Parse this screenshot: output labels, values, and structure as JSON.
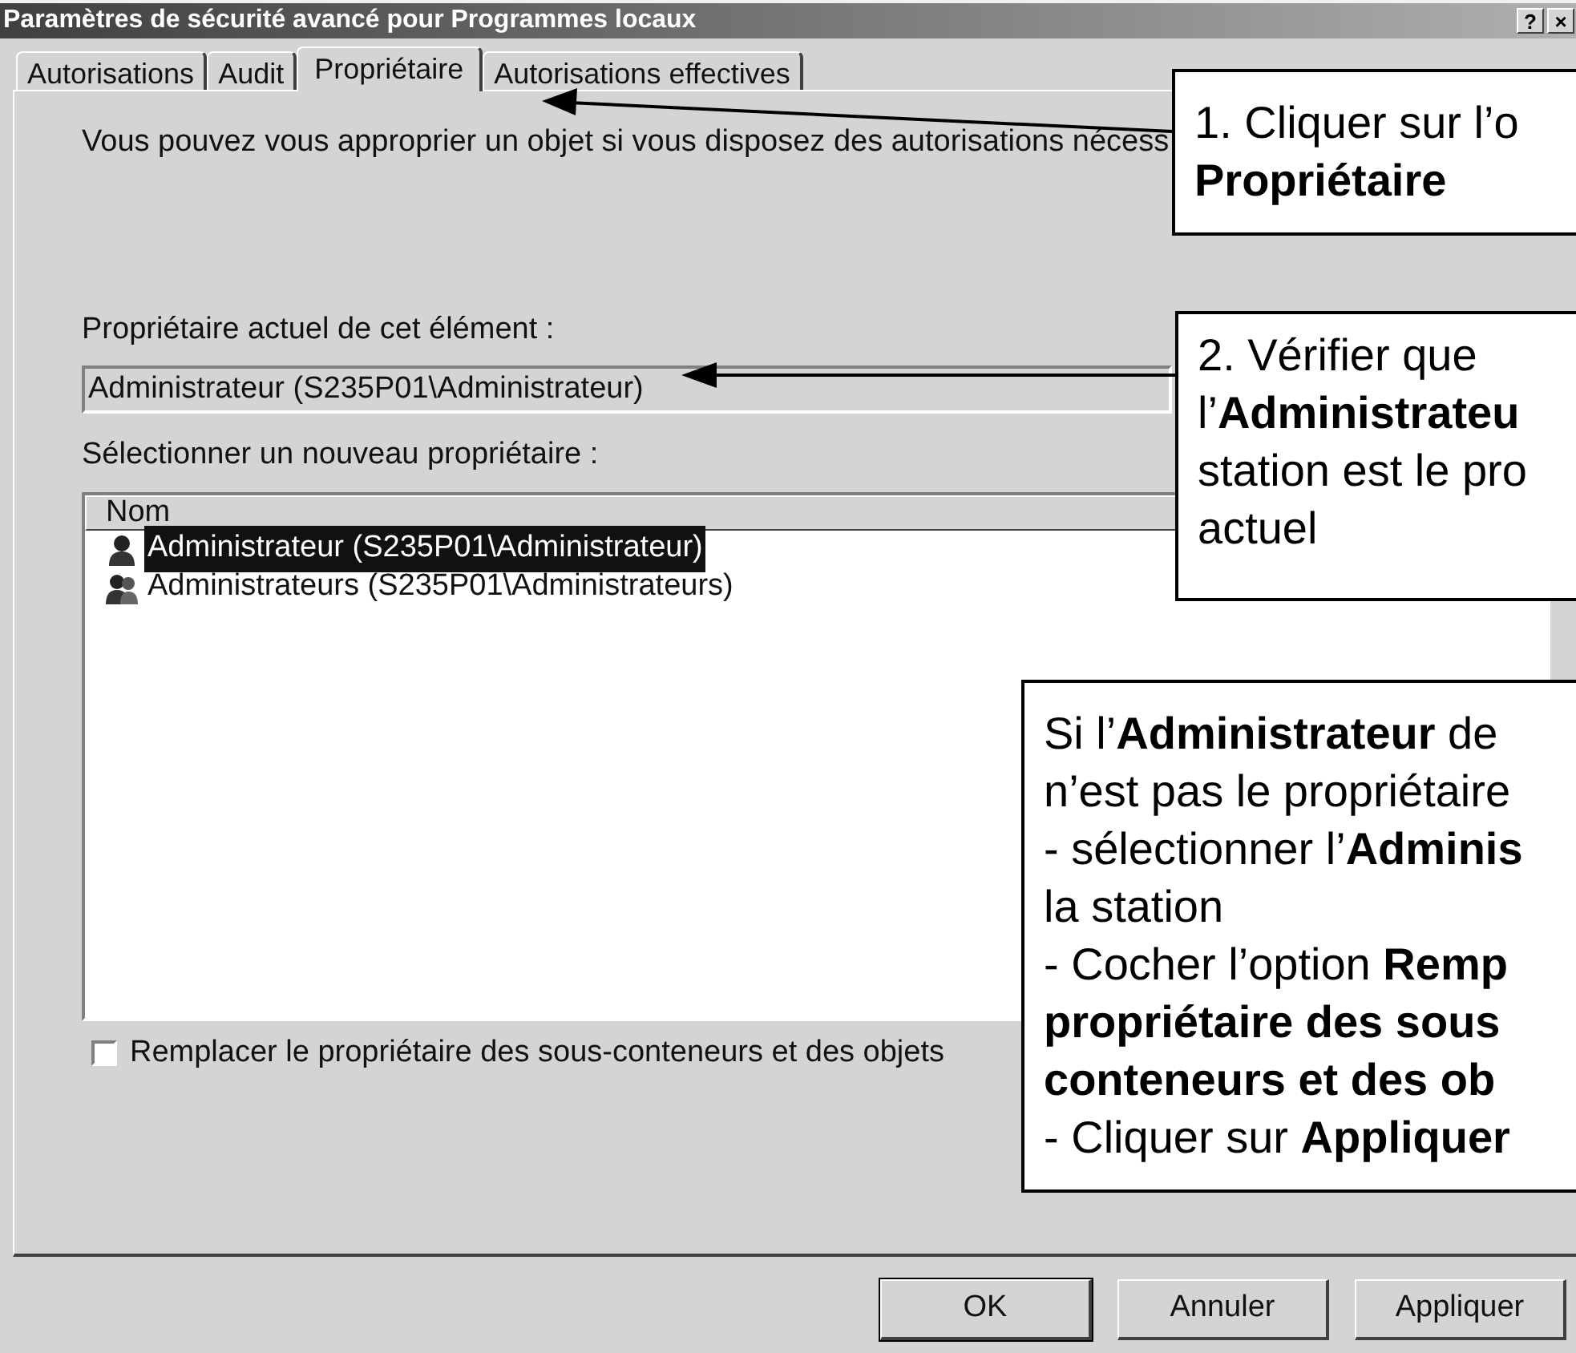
{
  "window": {
    "title": "Paramètres de sécurité avancé pour Programmes locaux",
    "buttons": [
      "?",
      "×"
    ]
  },
  "tabs": [
    {
      "label": "Autorisations",
      "selected": false
    },
    {
      "label": "Audit",
      "selected": false
    },
    {
      "label": "Propriétaire",
      "selected": true
    },
    {
      "label": "Autorisations effectives",
      "selected": false
    }
  ],
  "intro": "Vous pouvez vous approprier un objet si vous disposez des autorisations nécess",
  "current_owner": {
    "label": "Propriétaire actuel de cet élément :",
    "value": "Administrateur (S235P01\\Administrateur)"
  },
  "new_owner": {
    "label": "Sélectionner un nouveau propriétaire :",
    "columns": [
      "Nom"
    ],
    "rows": [
      {
        "name": "Administrateur (S235P01\\Administrateur)",
        "kind": "user",
        "selected": true
      },
      {
        "name": "Administrateurs (S235P01\\Administrateurs)",
        "kind": "group",
        "selected": false
      }
    ]
  },
  "replace_option": {
    "label": "Remplacer le propriétaire des sous-conteneurs et des objets",
    "checked": false
  },
  "buttons": [
    {
      "label": "OK",
      "default": true
    },
    {
      "label": "Annuler",
      "default": false
    },
    {
      "label": "Appliquer",
      "default": false
    }
  ],
  "callouts": [
    {
      "lines": [
        "1. Cliquer sur l’o",
        "**Propriétaire**"
      ]
    },
    {
      "lines": [
        "2. Vérifier que",
        "l’**Administrateu**",
        "station est le pro",
        "actuel"
      ]
    },
    {
      "lines": [
        "Si l’**Administrateur** de",
        "n’est pas le propriétaire",
        "- sélectionner l’**Adminis**",
        "la station",
        "- Cocher l’option **Remp**",
        "**propriétaire des sous**",
        "**conteneurs et des ob**",
        "- Cliquer sur **Appliquer**"
      ]
    }
  ]
}
